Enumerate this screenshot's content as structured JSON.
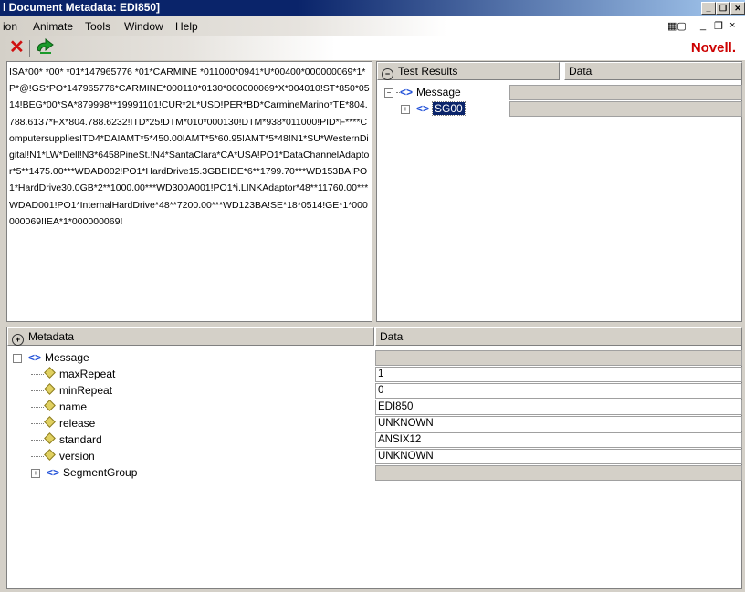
{
  "window": {
    "title": "l Document Metadata: EDI850]",
    "controls": [
      "_",
      "❐",
      "✕"
    ]
  },
  "menubar": {
    "items": [
      {
        "label": "ion"
      },
      {
        "label": "Animate"
      },
      {
        "label": "Tools"
      },
      {
        "label": "Window"
      },
      {
        "label": "Help"
      }
    ],
    "mdi_controls": [
      "_",
      "❐",
      "×"
    ]
  },
  "toolbar": {
    "brand": "Novell.",
    "icons": [
      "close-x-icon",
      "refresh-arrow-icon"
    ]
  },
  "edi_source": {
    "text": "ISA*00*       *00*       *01*147965776     *01*CARMINE *011000*0941*U*00400*000000069*1*P*@!GS*PO*147965776*CARMINE*000110*0130*000000069*X*004010!ST*850*0514!BEG*00*SA*879998**19991101!CUR*2L*USD!PER*BD*CarmineMarino*TE*804.788.6137*FX*804.788.6232!ITD*25!DTM*010*000130!DTM*938*011000!PID*F****Computersupplies!TD4*DA!AMT*5*450.00!AMT*5*60.95!AMT*5*48!N1*SU*WesternDigital!N1*LW*Dell!N3*6458PineSt.!N4*SantaClara*CA*USA!PO1*DataChannelAdaptor*5**1475.00***WDAD002!PO1*HardDrive15.3GBEIDE*6**1799.70***WD153BA!PO1*HardDrive30.0GB*2**1000.00***WD300A001!PO1*i.LINKAdaptor*48**11760.00***WDAD001!PO1*InternalHardDrive*48**7200.00***WD123BA!SE*18*0514!GE*1*000000069!IEA*1*000000069!"
  },
  "test_results": {
    "header_left": "Test Results",
    "header_right": "Data",
    "tree": [
      {
        "label": "Message",
        "expander": "−"
      },
      {
        "label": "SG00",
        "expander": "+"
      }
    ]
  },
  "metadata": {
    "header_left": "Metadata",
    "header_right": "Data",
    "root": {
      "label": "Message",
      "expander": "−"
    },
    "properties": [
      {
        "name": "maxRepeat",
        "value": "1"
      },
      {
        "name": "minRepeat",
        "value": "0"
      },
      {
        "name": "name",
        "value": "EDI850"
      },
      {
        "name": "release",
        "value": "UNKNOWN"
      },
      {
        "name": "standard",
        "value": "ANSIX12"
      },
      {
        "name": "version",
        "value": "UNKNOWN"
      }
    ],
    "child": {
      "label": "SegmentGroup",
      "expander": "+"
    }
  },
  "colors": {
    "title_bar": "#0a246a",
    "tag_blue": "#1f4fd8",
    "brand_red": "#cc0000",
    "selection": "#0a246a"
  }
}
